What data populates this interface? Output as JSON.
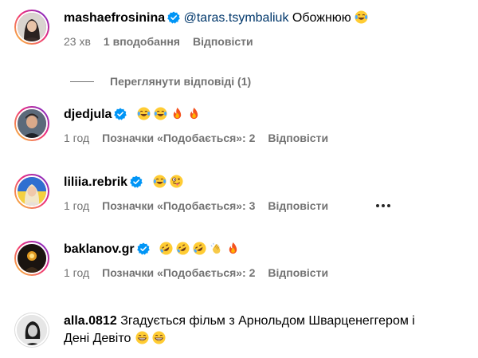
{
  "colors": {
    "text": "#000000",
    "muted": "#737373",
    "mention": "#00376b",
    "verified": "#0095f6"
  },
  "comments": [
    {
      "username": "mashaefrosinina",
      "mention": "@taras.tsymbaliuk",
      "text": "Обожнюю",
      "emojis": [
        "laughing-tears"
      ],
      "time": "23 хв",
      "likes": "1 вподобання",
      "reply": "Відповісти"
    },
    {
      "username": "djedjula",
      "text": "",
      "emojis": [
        "laughing-tears",
        "laughing-tears",
        "fire",
        "fire"
      ],
      "time": "1 год",
      "likes": "Позначки «Подобається»: 2",
      "reply": "Відповісти"
    },
    {
      "username": "liliia.rebrik",
      "text": "",
      "emojis": [
        "laughing-tears",
        "zany-face"
      ],
      "time": "1 год",
      "likes": "Позначки «Подобається»: 3",
      "reply": "Відповісти"
    },
    {
      "username": "baklanov.gr",
      "text": "",
      "emojis": [
        "rofl",
        "rofl",
        "rofl",
        "clapping-hands",
        "fire"
      ],
      "time": "1 год",
      "likes": "Позначки «Подобається»: 2",
      "reply": "Відповісти"
    },
    {
      "username": "alla.0812",
      "text_line1": "Згадується фільм з Арнольдом Шварценеггером і",
      "text_line2": "Дені Девіто",
      "emojis": [
        "grinning-face",
        "grinning-face"
      ]
    }
  ],
  "view_replies": "Переглянути відповіді (1)"
}
